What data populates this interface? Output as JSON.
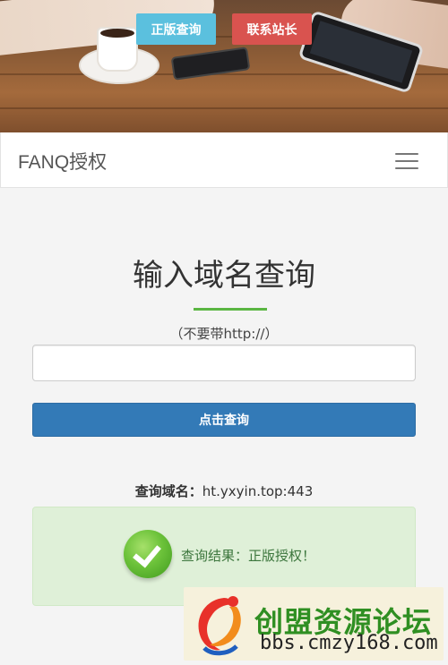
{
  "hero": {
    "genuine_button": "正版查询",
    "contact_button": "联系站长"
  },
  "navbar": {
    "brand": "FANQ授权",
    "menu_icon": "hamburger-menu-icon"
  },
  "main": {
    "title": "输入域名查询",
    "hint": "（不要带http://）",
    "input_value": "",
    "query_button": "点击查询"
  },
  "result": {
    "queried_label": "查询域名：",
    "queried_value": "ht.yxyin.top:443",
    "status_icon": "check-circle-icon",
    "result_text": "查询结果：正版授权！"
  },
  "watermark": {
    "title": "创盟资源论坛",
    "url": "bbs.cmzy168.com"
  },
  "colors": {
    "accent_green": "#5ab642",
    "primary_blue": "#337ab7",
    "info_cyan": "#5bc0de",
    "danger_red": "#d9534f",
    "success_bg": "#dff0d8"
  }
}
